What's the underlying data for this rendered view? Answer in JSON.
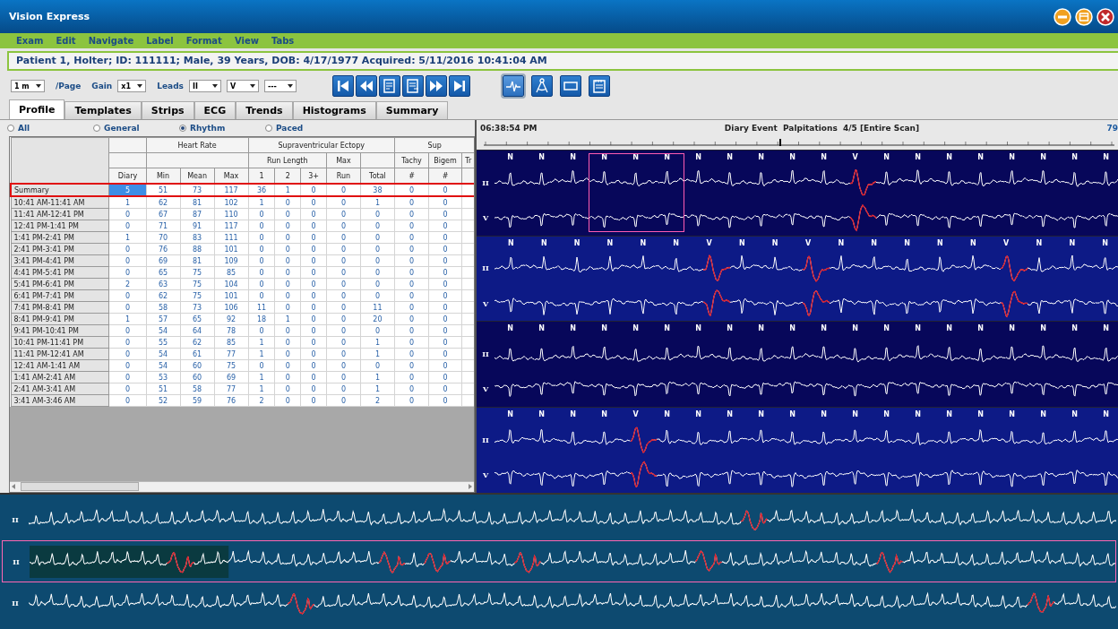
{
  "window": {
    "title": "Vision Express"
  },
  "menu": [
    "Exam",
    "Edit",
    "Navigate",
    "Label",
    "Format",
    "View",
    "Tabs"
  ],
  "patient_info": "Patient 1, Holter; ID: 111111; Male, 39 Years, DOB: 4/17/1977 Acquired: 5/11/2016 10:41:04 AM",
  "toolbar": {
    "page_select": "1 m",
    "page_label": "/Page",
    "gain_label": "Gain",
    "gain_select": "x1",
    "leads_label": "Leads",
    "lead_selects": [
      "II",
      "V",
      "---"
    ],
    "tools": [
      {
        "kind": "waveform",
        "selected": true
      },
      {
        "kind": "caliper",
        "selected": false
      },
      {
        "kind": "rectangle",
        "selected": false
      },
      {
        "kind": "notepad",
        "selected": false
      }
    ]
  },
  "tabs": [
    {
      "label": "Profile",
      "selected": true
    },
    {
      "label": "Templates",
      "selected": false
    },
    {
      "label": "Strips",
      "selected": false
    },
    {
      "label": "ECG",
      "selected": false
    },
    {
      "label": "Trends",
      "selected": false
    },
    {
      "label": "Histograms",
      "selected": false
    },
    {
      "label": "Summary",
      "selected": false
    }
  ],
  "filters": [
    {
      "label": "All",
      "selected": false
    },
    {
      "label": "General",
      "selected": false
    },
    {
      "label": "Rhythm",
      "selected": true
    },
    {
      "label": "Paced",
      "selected": false
    }
  ],
  "table": {
    "groups": [
      {
        "subgroups": [
          {
            "columns": [
              "Diary"
            ]
          }
        ]
      },
      {
        "label": "Heart Rate",
        "subgroups": [
          {
            "columns": [
              "Min",
              "Mean",
              "Max"
            ]
          }
        ]
      },
      {
        "label": "Supraventricular Ectopy",
        "subgroups": [
          {
            "label": "Run Length",
            "columns": [
              "1",
              "2",
              "3+"
            ]
          },
          {
            "label": "Max",
            "columns": [
              "Run"
            ]
          },
          {
            "columns": [
              "Total"
            ]
          }
        ]
      },
      {
        "label": "Sup",
        "subgroups": [
          {
            "label": "Tachy",
            "columns": [
              "#"
            ]
          },
          {
            "label": "Bigem",
            "columns": [
              "#"
            ]
          },
          {
            "label": "Tr"
          }
        ]
      }
    ],
    "rows": [
      {
        "label": "Summary",
        "selected": true,
        "cells": [
          "5",
          "51",
          "73",
          "117",
          "36",
          "1",
          "0",
          "0",
          "38",
          "0",
          "0"
        ]
      },
      {
        "label": "10:41 AM-11:41 AM",
        "selected": false,
        "cells": [
          "1",
          "62",
          "81",
          "102",
          "1",
          "0",
          "0",
          "0",
          "1",
          "0",
          "0"
        ]
      },
      {
        "label": "11:41 AM-12:41 PM",
        "selected": false,
        "cells": [
          "0",
          "67",
          "87",
          "110",
          "0",
          "0",
          "0",
          "0",
          "0",
          "0",
          "0"
        ]
      },
      {
        "label": "12:41 PM-1:41 PM",
        "selected": false,
        "cells": [
          "0",
          "71",
          "91",
          "117",
          "0",
          "0",
          "0",
          "0",
          "0",
          "0",
          "0"
        ]
      },
      {
        "label": "1:41 PM-2:41 PM",
        "selected": false,
        "cells": [
          "1",
          "70",
          "83",
          "111",
          "0",
          "0",
          "0",
          "0",
          "0",
          "0",
          "0"
        ]
      },
      {
        "label": "2:41 PM-3:41 PM",
        "selected": false,
        "cells": [
          "0",
          "76",
          "88",
          "101",
          "0",
          "0",
          "0",
          "0",
          "0",
          "0",
          "0"
        ]
      },
      {
        "label": "3:41 PM-4:41 PM",
        "selected": false,
        "cells": [
          "0",
          "69",
          "81",
          "109",
          "0",
          "0",
          "0",
          "0",
          "0",
          "0",
          "0"
        ]
      },
      {
        "label": "4:41 PM-5:41 PM",
        "selected": false,
        "cells": [
          "0",
          "65",
          "75",
          "85",
          "0",
          "0",
          "0",
          "0",
          "0",
          "0",
          "0"
        ]
      },
      {
        "label": "5:41 PM-6:41 PM",
        "selected": false,
        "cells": [
          "2",
          "63",
          "75",
          "104",
          "0",
          "0",
          "0",
          "0",
          "0",
          "0",
          "0"
        ]
      },
      {
        "label": "6:41 PM-7:41 PM",
        "selected": false,
        "cells": [
          "0",
          "62",
          "75",
          "101",
          "0",
          "0",
          "0",
          "0",
          "0",
          "0",
          "0"
        ]
      },
      {
        "label": "7:41 PM-8:41 PM",
        "selected": false,
        "cells": [
          "0",
          "58",
          "73",
          "106",
          "11",
          "0",
          "0",
          "0",
          "11",
          "0",
          "0"
        ]
      },
      {
        "label": "8:41 PM-9:41 PM",
        "selected": false,
        "cells": [
          "1",
          "57",
          "65",
          "92",
          "18",
          "1",
          "0",
          "0",
          "20",
          "0",
          "0"
        ]
      },
      {
        "label": "9:41 PM-10:41 PM",
        "selected": false,
        "cells": [
          "0",
          "54",
          "64",
          "78",
          "0",
          "0",
          "0",
          "0",
          "0",
          "0",
          "0"
        ]
      },
      {
        "label": "10:41 PM-11:41 PM",
        "selected": false,
        "cells": [
          "0",
          "55",
          "62",
          "85",
          "1",
          "0",
          "0",
          "0",
          "1",
          "0",
          "0"
        ]
      },
      {
        "label": "11:41 PM-12:41 AM",
        "selected": false,
        "cells": [
          "0",
          "54",
          "61",
          "77",
          "1",
          "0",
          "0",
          "0",
          "1",
          "0",
          "0"
        ]
      },
      {
        "label": "12:41 AM-1:41 AM",
        "selected": false,
        "cells": [
          "0",
          "54",
          "60",
          "75",
          "0",
          "0",
          "0",
          "0",
          "0",
          "0",
          "0"
        ]
      },
      {
        "label": "1:41 AM-2:41 AM",
        "selected": false,
        "cells": [
          "0",
          "53",
          "60",
          "69",
          "1",
          "0",
          "0",
          "0",
          "1",
          "0",
          "0"
        ]
      },
      {
        "label": "2:41 AM-3:41 AM",
        "selected": false,
        "cells": [
          "0",
          "51",
          "58",
          "77",
          "1",
          "0",
          "0",
          "0",
          "1",
          "0",
          "0"
        ]
      },
      {
        "label": "3:41 AM-3:46 AM",
        "selected": false,
        "cells": [
          "0",
          "52",
          "59",
          "76",
          "2",
          "0",
          "0",
          "0",
          "2",
          "0",
          "0"
        ]
      }
    ]
  },
  "strip_header": {
    "time": "06:38:54 PM",
    "event": "Diary Event  Palpitations  4/5 [Entire Scan]",
    "count": "79"
  },
  "strips": [
    {
      "leads": [
        "II",
        "V"
      ],
      "beats": [
        {
          "label": "N",
          "kind": "normal"
        },
        {
          "label": "N",
          "kind": "normal"
        },
        {
          "label": "N",
          "kind": "normal"
        },
        {
          "label": "N",
          "kind": "normal"
        },
        {
          "label": "N",
          "kind": "normal"
        },
        {
          "label": "N",
          "kind": "normal"
        },
        {
          "label": "N",
          "kind": "normal"
        },
        {
          "label": "N",
          "kind": "normal"
        },
        {
          "label": "N",
          "kind": "normal"
        },
        {
          "label": "N",
          "kind": "normal"
        },
        {
          "label": "N",
          "kind": "normal"
        },
        {
          "label": "V",
          "kind": "ventricular"
        },
        {
          "label": "N",
          "kind": "normal"
        },
        {
          "label": "N",
          "kind": "normal"
        },
        {
          "label": "N",
          "kind": "normal"
        },
        {
          "label": "N",
          "kind": "normal"
        },
        {
          "label": "N",
          "kind": "normal"
        },
        {
          "label": "N",
          "kind": "normal"
        },
        {
          "label": "N",
          "kind": "normal"
        },
        {
          "label": "N",
          "kind": "normal"
        }
      ]
    },
    {
      "leads": [
        "II",
        "V"
      ],
      "beats": [
        {
          "label": "N",
          "kind": "normal"
        },
        {
          "label": "N",
          "kind": "normal"
        },
        {
          "label": "N",
          "kind": "normal"
        },
        {
          "label": "N",
          "kind": "normal"
        },
        {
          "label": "N",
          "kind": "normal"
        },
        {
          "label": "N",
          "kind": "normal"
        },
        {
          "label": "V",
          "kind": "ventricular"
        },
        {
          "label": "N",
          "kind": "normal"
        },
        {
          "label": "N",
          "kind": "normal"
        },
        {
          "label": "V",
          "kind": "ventricular"
        },
        {
          "label": "N",
          "kind": "normal"
        },
        {
          "label": "N",
          "kind": "normal"
        },
        {
          "label": "N",
          "kind": "normal"
        },
        {
          "label": "N",
          "kind": "normal"
        },
        {
          "label": "N",
          "kind": "normal"
        },
        {
          "label": "V",
          "kind": "ventricular"
        },
        {
          "label": "N",
          "kind": "normal"
        },
        {
          "label": "N",
          "kind": "normal"
        },
        {
          "label": "N",
          "kind": "normal"
        }
      ]
    },
    {
      "leads": [
        "II",
        "V"
      ],
      "beats": [
        {
          "label": "N",
          "kind": "normal"
        },
        {
          "label": "N",
          "kind": "normal"
        },
        {
          "label": "N",
          "kind": "normal"
        },
        {
          "label": "N",
          "kind": "normal"
        },
        {
          "label": "N",
          "kind": "normal"
        },
        {
          "label": "N",
          "kind": "normal"
        },
        {
          "label": "N",
          "kind": "normal"
        },
        {
          "label": "N",
          "kind": "normal"
        },
        {
          "label": "N",
          "kind": "normal"
        },
        {
          "label": "N",
          "kind": "normal"
        },
        {
          "label": "N",
          "kind": "normal"
        },
        {
          "label": "N",
          "kind": "normal"
        },
        {
          "label": "N",
          "kind": "normal"
        },
        {
          "label": "N",
          "kind": "normal"
        },
        {
          "label": "N",
          "kind": "normal"
        },
        {
          "label": "N",
          "kind": "normal"
        },
        {
          "label": "N",
          "kind": "normal"
        },
        {
          "label": "N",
          "kind": "normal"
        },
        {
          "label": "N",
          "kind": "normal"
        },
        {
          "label": "N",
          "kind": "normal"
        }
      ]
    },
    {
      "leads": [
        "II",
        "V"
      ],
      "beats": [
        {
          "label": "N",
          "kind": "normal"
        },
        {
          "label": "N",
          "kind": "normal"
        },
        {
          "label": "N",
          "kind": "normal"
        },
        {
          "label": "N",
          "kind": "normal"
        },
        {
          "label": "V",
          "kind": "ventricular"
        },
        {
          "label": "N",
          "kind": "normal"
        },
        {
          "label": "N",
          "kind": "normal"
        },
        {
          "label": "N",
          "kind": "normal"
        },
        {
          "label": "N",
          "kind": "normal"
        },
        {
          "label": "N",
          "kind": "normal"
        },
        {
          "label": "N",
          "kind": "normal"
        },
        {
          "label": "N",
          "kind": "normal"
        },
        {
          "label": "N",
          "kind": "normal"
        },
        {
          "label": "N",
          "kind": "normal"
        },
        {
          "label": "N",
          "kind": "normal"
        },
        {
          "label": "N",
          "kind": "normal"
        },
        {
          "label": "N",
          "kind": "normal"
        },
        {
          "label": "N",
          "kind": "normal"
        },
        {
          "label": "N",
          "kind": "normal"
        },
        {
          "label": "N",
          "kind": "normal"
        }
      ]
    }
  ],
  "overview": {
    "leads": [
      "II",
      "II",
      "II"
    ]
  }
}
